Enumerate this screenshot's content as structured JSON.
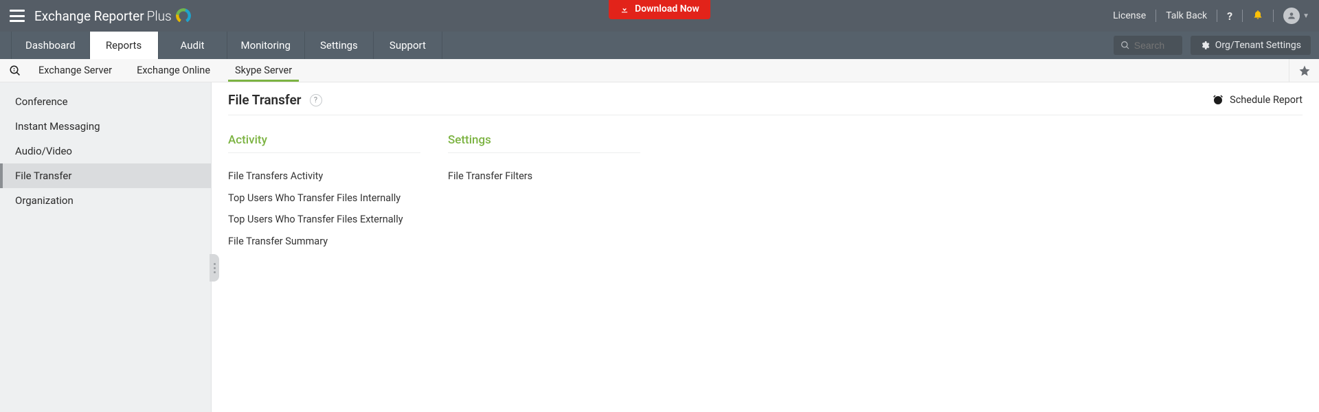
{
  "banner": {
    "product_name": "Exchange Reporter",
    "product_suffix": "Plus",
    "download_label": "Download Now",
    "license_label": "License",
    "talkback_label": "Talk Back"
  },
  "nav": {
    "tabs": [
      {
        "label": "Dashboard"
      },
      {
        "label": "Reports"
      },
      {
        "label": "Audit"
      },
      {
        "label": "Monitoring"
      },
      {
        "label": "Settings"
      },
      {
        "label": "Support"
      }
    ],
    "active_tab_index": 1,
    "search_placeholder": "Search",
    "org_settings_label": "Org/Tenant Settings"
  },
  "subnav": {
    "tabs": [
      {
        "label": "Exchange Server"
      },
      {
        "label": "Exchange Online"
      },
      {
        "label": "Skype Server"
      }
    ],
    "active_subtab_index": 2
  },
  "sidebar": {
    "items": [
      {
        "label": "Conference"
      },
      {
        "label": "Instant Messaging"
      },
      {
        "label": "Audio/Video"
      },
      {
        "label": "File Transfer"
      },
      {
        "label": "Organization"
      }
    ],
    "active_index": 3
  },
  "page": {
    "title": "File Transfer",
    "schedule_label": "Schedule Report",
    "sections": [
      {
        "heading": "Activity",
        "links": [
          "File Transfers Activity",
          "Top Users Who Transfer Files Internally",
          "Top Users Who Transfer Files Externally",
          "File Transfer Summary"
        ]
      },
      {
        "heading": "Settings",
        "links": [
          "File Transfer Filters"
        ]
      }
    ]
  }
}
